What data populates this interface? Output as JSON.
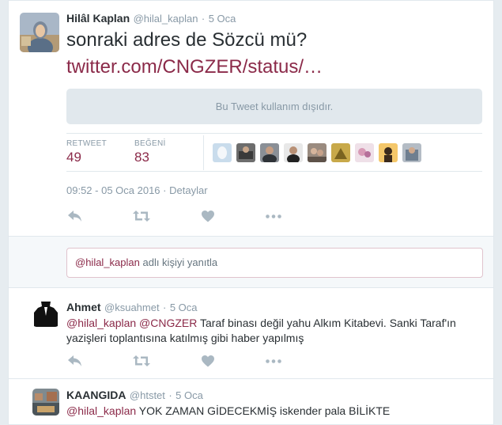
{
  "main_tweet": {
    "name": "Hilâl Kaplan",
    "handle": "@hilal_kaplan",
    "dot": "·",
    "time": "5 Oca",
    "text": "sonraki adres de Sözcü mü?",
    "link": "twitter.com/CNGZER/status/…",
    "withheld_text": "Bu Tweet kullanım dışıdır.",
    "retweet_label": "RETWEET",
    "retweet_count": "49",
    "like_label": "BEĞENİ",
    "like_count": "83",
    "timestamp": "09:52 - 05 Oca 2016",
    "details_label": "Detaylar"
  },
  "reply_box": {
    "mention": "@hilal_kaplan",
    "prompt": "adlı kişiyi yanıtla"
  },
  "replies": [
    {
      "name": "Ahmet",
      "handle": "@ksuahmet",
      "dot": "·",
      "time": "5 Oca",
      "mention1": "@hilal_kaplan",
      "mention2": "@CNGZER",
      "text1": "Taraf binası değil yahu Alkım Kitabevi. Sanki Taraf'ın",
      "text2": "yazişleri toplantısına katılmış gibi haber yapılmış"
    },
    {
      "name": "KAANGIDA",
      "handle": "@htstet",
      "dot": "·",
      "time": "5 Oca",
      "mention1": "@hilal_kaplan",
      "text1": "YOK ZAMAN GİDECEKMİŞ iskender pala BİLİKTE"
    }
  ],
  "colors": {
    "link": "#8b2a49",
    "count": "#8b2a49",
    "meta": "#8899a6",
    "action_icon": "#aab8c2"
  },
  "icons": {
    "reply": "reply-icon",
    "retweet": "retweet-icon",
    "like": "heart-icon",
    "more": "more-icon"
  }
}
